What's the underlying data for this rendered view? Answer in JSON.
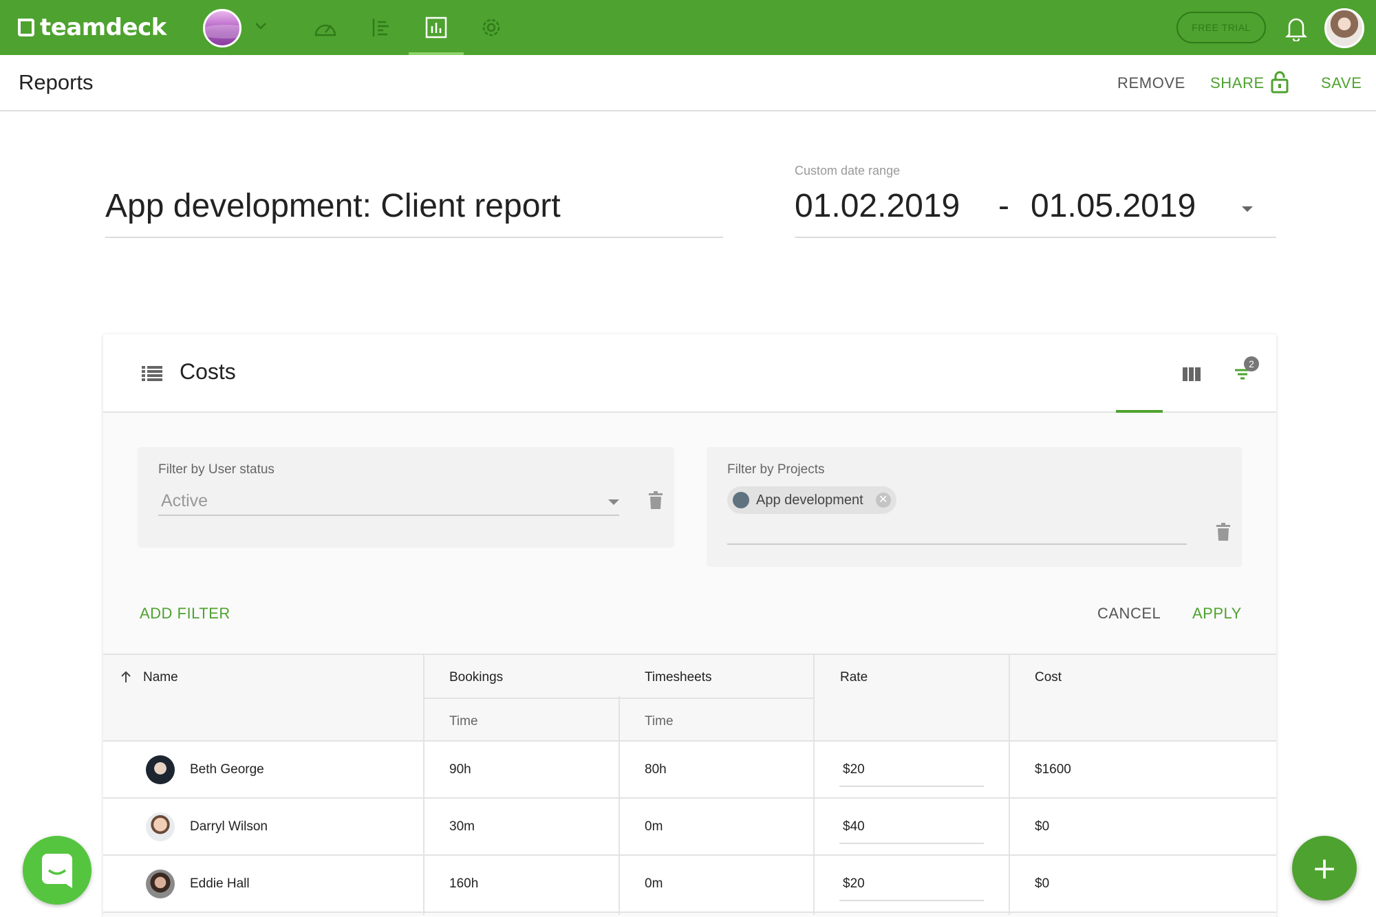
{
  "app": {
    "logo_text": "teamdeck",
    "trial_label": "FREE TRIAL"
  },
  "nav": {
    "icons": [
      "dashboard-icon",
      "planner-icon",
      "reports-icon",
      "settings-icon"
    ],
    "active": "reports-icon"
  },
  "header": {
    "title": "Reports",
    "remove_label": "REMOVE",
    "share_label": "SHARE",
    "save_label": "SAVE"
  },
  "report": {
    "title": "App development: Client report",
    "date_label": "Custom date range",
    "date_start": "01.02.2019",
    "date_sep": "-",
    "date_end": "01.05.2019"
  },
  "card": {
    "title": "Costs",
    "filter_badge": "2",
    "filters": {
      "user_status_label": "Filter by User status",
      "user_status_value": "Active",
      "projects_label": "Filter by Projects",
      "project_chip": "App development"
    },
    "add_filter_label": "ADD FILTER",
    "cancel_label": "CANCEL",
    "apply_label": "APPLY"
  },
  "table": {
    "columns": {
      "name": "Name",
      "bookings": "Bookings",
      "bookings_sub": "Time",
      "timesheets": "Timesheets",
      "timesheets_sub": "Time",
      "rate": "Rate",
      "cost": "Cost"
    },
    "rows": [
      {
        "name": "Beth George",
        "bookings": "90h",
        "timesheets": "80h",
        "rate": "$20",
        "cost": "$1600"
      },
      {
        "name": "Darryl Wilson",
        "bookings": "30m",
        "timesheets": "0m",
        "rate": "$40",
        "cost": "$0"
      },
      {
        "name": "Eddie Hall",
        "bookings": "160h",
        "timesheets": "0m",
        "rate": "$20",
        "cost": "$0"
      }
    ]
  },
  "fab": {
    "label": "+"
  },
  "colors": {
    "brand": "#4ea22f",
    "chat": "#55c53f"
  }
}
